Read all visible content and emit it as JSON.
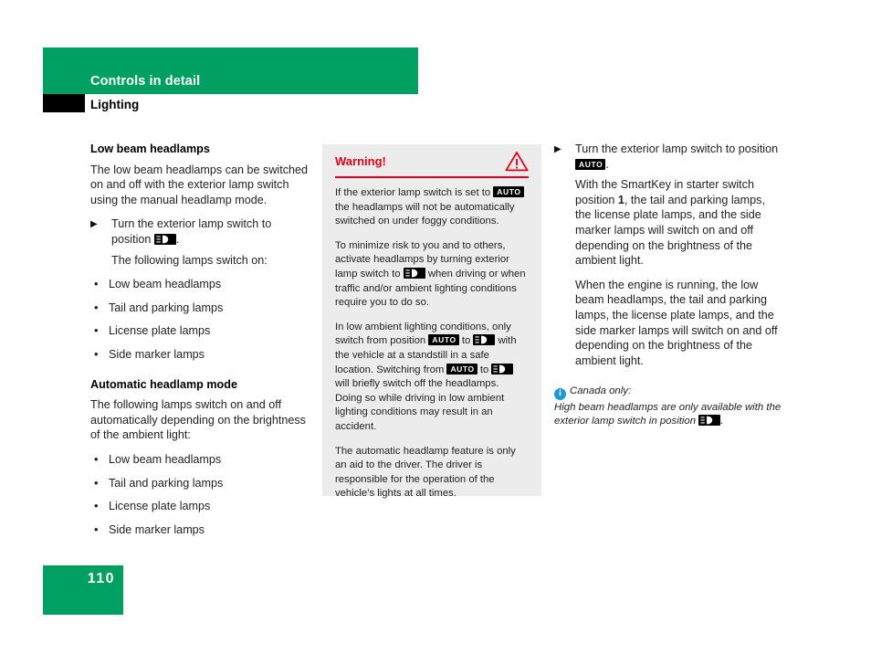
{
  "header": {
    "section_title": "Controls in detail",
    "subtitle": "Lighting"
  },
  "colors": {
    "brand_green": "#00a160",
    "warning_red": "#e2001a",
    "info_blue": "#1c9ad6",
    "warning_bg": "#ececec"
  },
  "icons": {
    "low_beam_badge": "low-beam-headlamp-icon",
    "auto_badge_label": "AUTO",
    "warning_triangle": "warning-triangle-icon",
    "info_circle": "info-circle-icon",
    "step_arrow": "▶"
  },
  "left_column": {
    "heading_1": "Low beam headlamps",
    "intro_1": "The low beam headlamps can be switched on and off with the exterior lamp switch using the manual headlamp mode.",
    "step_1_prefix": "Turn the exterior lamp switch to position",
    "step_1_suffix": ".",
    "step_1_note": "The following lamps switch on:",
    "list_1": [
      "Low beam headlamps",
      "Tail and parking lamps",
      "License plate lamps",
      "Side marker lamps"
    ],
    "heading_2": "Automatic headlamp mode",
    "intro_2": "The following lamps switch on and off automatically depending on the brightness of the ambient light:",
    "list_2": [
      "Low beam headlamps",
      "Tail and parking lamps",
      "License plate lamps",
      "Side marker lamps"
    ]
  },
  "warning": {
    "title": "Warning!",
    "p1_a": "If the exterior lamp switch is set to",
    "p1_b": "the headlamps will not be automatically switched on under foggy conditions.",
    "p2_a": "To minimize risk to you and to others, activate headlamps by turning exterior lamp switch to",
    "p2_b": "when driving or when traffic and/or ambient lighting conditions require you to do so.",
    "p3_a": "In low ambient lighting conditions, only switch from position",
    "p3_b": "to",
    "p3_c": "with the vehicle at a standstill in a safe location. Switching from",
    "p3_d": "to",
    "p3_e": "will briefly switch off the headlamps. Doing so while driving in low ambient lighting conditions may result in an accident.",
    "p4": "The automatic headlamp feature is only an aid to the driver. The driver is responsible for the operation of the vehicle’s lights at all times."
  },
  "right_column": {
    "step_1_prefix": "Turn the exterior lamp switch to position",
    "step_1_suffix": ".",
    "para_1_a": "With the SmartKey in starter switch position",
    "para_1_bold": "1",
    "para_1_b": ", the tail and parking lamps, the license plate lamps, and the side marker lamps will switch on and off depending on the brightness of the ambient light.",
    "para_2": "When the engine is running, the low beam headlamps, the tail and parking lamps, the license plate lamps, and the side marker lamps will switch on and off depending on the brightness of the ambient light.",
    "note_label": "Canada only:",
    "note_text_a": "High beam headlamps are only available with the exterior lamp switch in position",
    "note_text_b": "."
  },
  "footer": {
    "page_number": "110"
  }
}
